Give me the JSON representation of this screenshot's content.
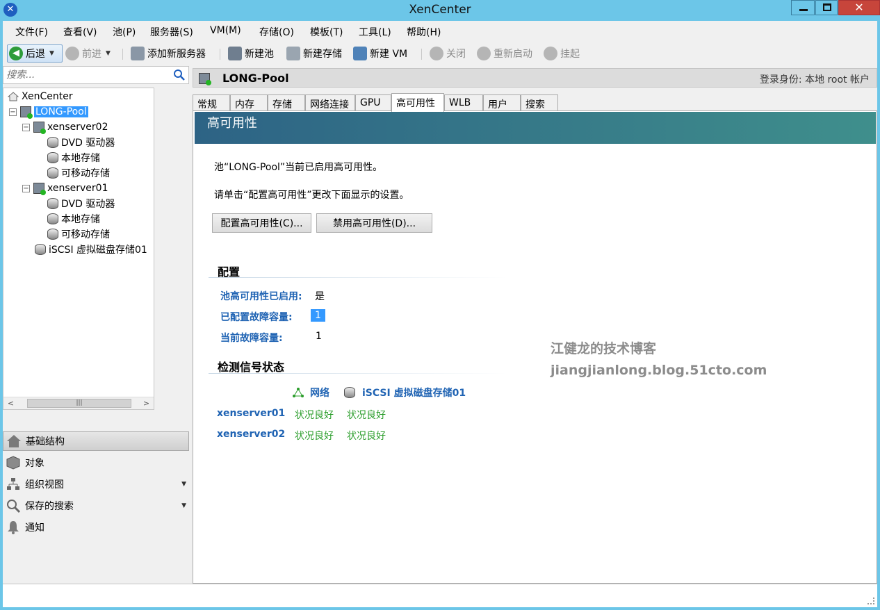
{
  "window": {
    "title": "XenCenter"
  },
  "menu": [
    "文件(F)",
    "查看(V)",
    "池(P)",
    "服务器(S)",
    "VM(M)",
    "存储(O)",
    "模板(T)",
    "工具(L)",
    "帮助(H)"
  ],
  "toolbar": {
    "back": "后退",
    "forward": "前进",
    "add_server": "添加新服务器",
    "new_pool": "新建池",
    "new_storage": "新建存储",
    "new_vm": "新建 VM",
    "shutdown": "关闭",
    "reboot": "重新启动",
    "suspend": "挂起"
  },
  "search": {
    "placeholder": "搜索..."
  },
  "tree": {
    "root": "XenCenter",
    "pool": "LONG-Pool",
    "host1": "xenserver02",
    "host1_items": [
      "DVD 驱动器",
      "本地存储",
      "可移动存储"
    ],
    "host2": "xenserver01",
    "host2_items": [
      "DVD 驱动器",
      "本地存储",
      "可移动存储"
    ],
    "shared_sr": "iSCSI 虚拟磁盘存储01"
  },
  "nav": [
    "基础结构",
    "对象",
    "组织视图",
    "保存的搜索",
    "通知"
  ],
  "header": {
    "pool_name": "LONG-Pool",
    "login": "登录身份:  本地 root 帐户"
  },
  "tabs": [
    "常规",
    "内存",
    "存储",
    "网络连接",
    "GPU",
    "高可用性",
    "WLB",
    "用户",
    "搜索"
  ],
  "ha": {
    "banner_title": "高可用性",
    "status_text": "池“LONG-Pool”当前已启用高可用性。",
    "hint_text": "请单击“配置高可用性”更改下面显示的设置。",
    "configure_button": "配置高可用性(C)...",
    "disable_button": "禁用高可用性(D)...",
    "config_section": "配置",
    "ha_enabled_label": "池高可用性已启用:",
    "ha_enabled_value": "是",
    "configured_tolerance_label": "已配置故障容量:",
    "configured_tolerance_value": "1",
    "current_tolerance_label": "当前故障容量:",
    "current_tolerance_value": "1",
    "heartbeat_section": "检测信号状态",
    "col_network": "网络",
    "col_storage": "iSCSI 虚拟磁盘存储01",
    "rows": [
      {
        "host": "xenserver01",
        "network": "状况良好",
        "storage": "状况良好"
      },
      {
        "host": "xenserver02",
        "network": "状况良好",
        "storage": "状况良好"
      }
    ]
  },
  "watermark": {
    "line1": "江健龙的技术博客",
    "line2": "jiangjianlong.blog.51cto.com"
  }
}
